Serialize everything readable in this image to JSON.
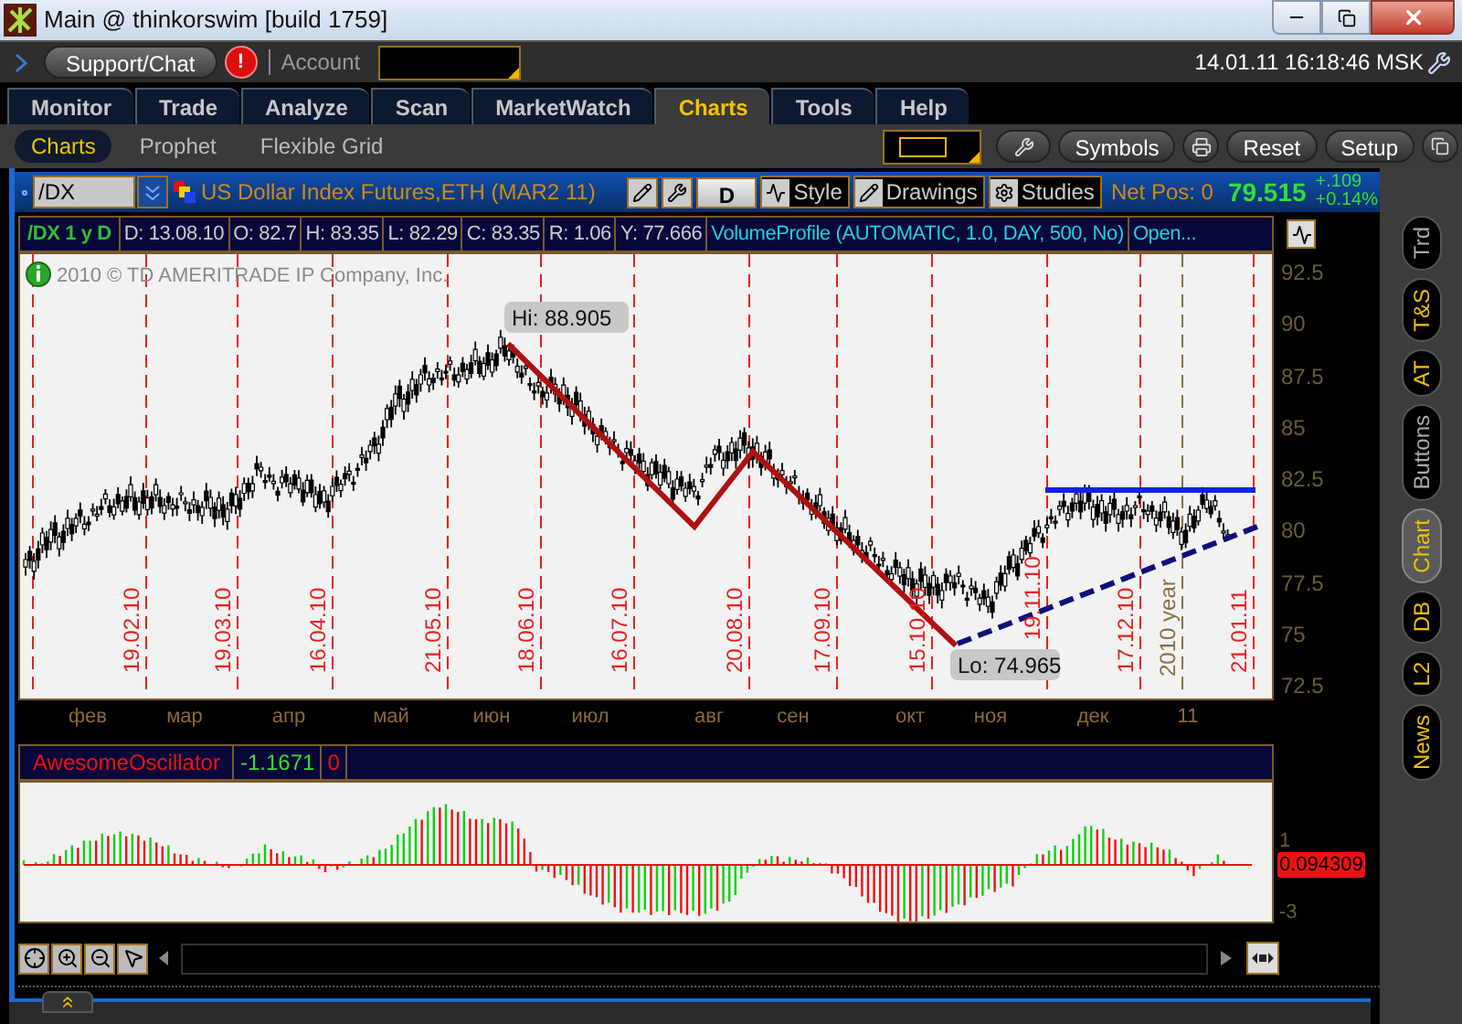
{
  "window": {
    "title": "Main @ thinkorswim [build 1759]"
  },
  "top_bar": {
    "support_button": "Support/Chat",
    "alert_badge": "!",
    "account_label": "Account",
    "clock": "14.01.11 16:18:46 MSK"
  },
  "tabs": [
    {
      "label": "Monitor",
      "selected": false
    },
    {
      "label": "Trade",
      "selected": false
    },
    {
      "label": "Analyze",
      "selected": false
    },
    {
      "label": "Scan",
      "selected": false
    },
    {
      "label": "MarketWatch",
      "selected": false
    },
    {
      "label": "Charts",
      "selected": true
    },
    {
      "label": "Tools",
      "selected": false
    },
    {
      "label": "Help",
      "selected": false
    }
  ],
  "subtabs": [
    {
      "label": "Charts",
      "selected": true
    },
    {
      "label": "Prophet",
      "selected": false
    },
    {
      "label": "Flexible Grid",
      "selected": false
    }
  ],
  "chart_toolbar": {
    "buttons": [
      "Symbols",
      "Reset",
      "Setup"
    ]
  },
  "chart_header": {
    "symbol": "/DX",
    "description": "US Dollar Index Futures,ETH (MAR2 11)",
    "aggregation": "D",
    "tool_buttons": [
      "Style",
      "Drawings",
      "Studies"
    ],
    "net_position": "Net Pos: 0",
    "last_price": "79.515",
    "change": "+.109",
    "change_percent": "+0.14%"
  },
  "info_row": {
    "title": "/DX 1 y D",
    "fields": [
      "D: 13.08.10",
      "O: 82.7",
      "H: 83.35",
      "L: 82.29",
      "C: 83.35",
      "R: 1.06",
      "Y: 77.666"
    ],
    "study": "VolumeProfile (AUTOMATIC, 1.0, DAY, 500, No)",
    "more": "Open..."
  },
  "price_chart": {
    "copyright": "2010 © TD AMERITRADE IP Company, Inc.",
    "high_label": "Hi: 88.905",
    "low_label": "Lo: 74.965",
    "price_axis": [
      "92.5",
      "90",
      "87.5",
      "85",
      "82.5",
      "80",
      "77.5",
      "75",
      "72.5"
    ],
    "date_markers": [
      {
        "label": "19.02.10",
        "kind": "date"
      },
      {
        "label": "19.03.10",
        "kind": "date"
      },
      {
        "label": "16.04.10",
        "kind": "date"
      },
      {
        "label": "21.05.10",
        "kind": "date"
      },
      {
        "label": "18.06.10",
        "kind": "date"
      },
      {
        "label": "16.07.10",
        "kind": "date"
      },
      {
        "label": "20.08.10",
        "kind": "date"
      },
      {
        "label": "17.09.10",
        "kind": "date"
      },
      {
        "label": "15.10.10",
        "kind": "date"
      },
      {
        "label": "19.11.10",
        "kind": "date"
      },
      {
        "label": "17.12.10",
        "kind": "date"
      },
      {
        "label": "2010 year",
        "kind": "year"
      },
      {
        "label": "21.01.11",
        "kind": "date"
      }
    ],
    "months": [
      "фев",
      "мар",
      "апр",
      "май",
      "июн",
      "июл",
      "авг",
      "сен",
      "окт",
      "ноя",
      "дек",
      "11"
    ]
  },
  "oscillator": {
    "name": "AwesomeOscillator",
    "value": "-1.1671",
    "zero": "0",
    "axis": [
      "1",
      "-3"
    ],
    "current_value": "0.094309"
  },
  "side_tabs": [
    {
      "label": "Trd",
      "selected": false,
      "dimmed": true
    },
    {
      "label": "T&S",
      "selected": false,
      "dimmed": false
    },
    {
      "label": "AT",
      "selected": false,
      "dimmed": false
    },
    {
      "label": "Buttons",
      "selected": false,
      "dimmed": true
    },
    {
      "label": "Chart",
      "selected": true,
      "dimmed": false
    },
    {
      "label": "DB",
      "selected": false,
      "dimmed": false
    },
    {
      "label": "L2",
      "selected": false,
      "dimmed": false
    },
    {
      "label": "News",
      "selected": false,
      "dimmed": false
    }
  ]
}
